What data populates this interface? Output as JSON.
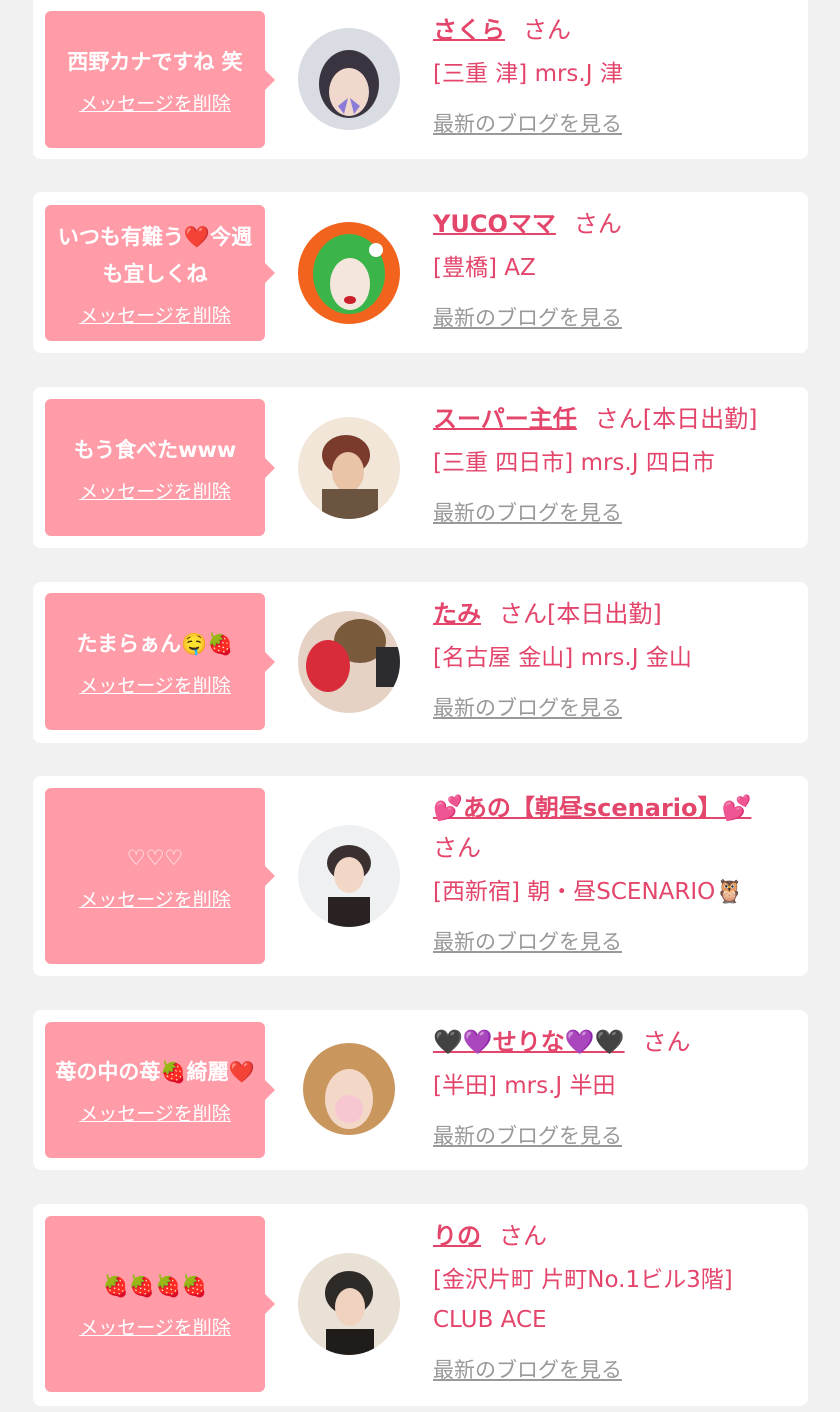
{
  "messages": [
    {
      "message": "西野カナですね 笑",
      "delete_label": "メッセージを削除",
      "name": "さくら",
      "honorific": "さん",
      "shop": "[三重 津] mrs.J 津",
      "blog_label": "最新のブログを見る",
      "avatar_colors": [
        "#d9dce2",
        "#3a3440"
      ]
    },
    {
      "message": "いつも有難う❤️今週も宜しくね",
      "delete_label": "メッセージを削除",
      "name": "YUCOママ",
      "honorific": "さん",
      "shop": "[豊橋] AZ",
      "blog_label": "最新のブログを見る",
      "avatar_colors": [
        "#f2641d",
        "#3bb54a"
      ]
    },
    {
      "message": "もう食べたwww",
      "delete_label": "メッセージを削除",
      "name": "スーパー主任",
      "honorific": "さん[本日出勤]",
      "shop": "[三重 四日市] mrs.J 四日市",
      "blog_label": "最新のブログを見る",
      "avatar_colors": [
        "#f1e6d8",
        "#7a3a2c"
      ]
    },
    {
      "message": "たまらぁん🤤🍓",
      "delete_label": "メッセージを削除",
      "name": "たみ",
      "honorific": "さん[本日出勤]",
      "shop": "[名古屋 金山] mrs.J 金山",
      "blog_label": "最新のブログを見る",
      "avatar_colors": [
        "#e6d2c4",
        "#d92b3a"
      ]
    },
    {
      "message": "♡♡♡",
      "delete_label": "メッセージを削除",
      "name": "💕あの【朝昼scenario】💕",
      "honorific": "さん",
      "shop": "[西新宿] 朝・昼SCENARIO🦉",
      "blog_label": "最新のブログを見る",
      "avatar_colors": [
        "#eef0f2",
        "#3b3030"
      ]
    },
    {
      "message": "苺の中の苺🍓綺麗❤️",
      "delete_label": "メッセージを削除",
      "name": "🖤💜せりな💜🖤",
      "honorific": "さん",
      "shop": "[半田] mrs.J 半田",
      "blog_label": "最新のブログを見る",
      "avatar_colors": [
        "#c9965e",
        "#f7c6d0"
      ]
    },
    {
      "message": "🍓🍓🍓🍓",
      "delete_label": "メッセージを削除",
      "name": "りの",
      "honorific": "さん",
      "shop": "[金沢片町 片町No.1ビル3階] CLUB ACE",
      "blog_label": "最新のブログを見る",
      "avatar_colors": [
        "#e9e1d6",
        "#2d2a28"
      ]
    }
  ]
}
